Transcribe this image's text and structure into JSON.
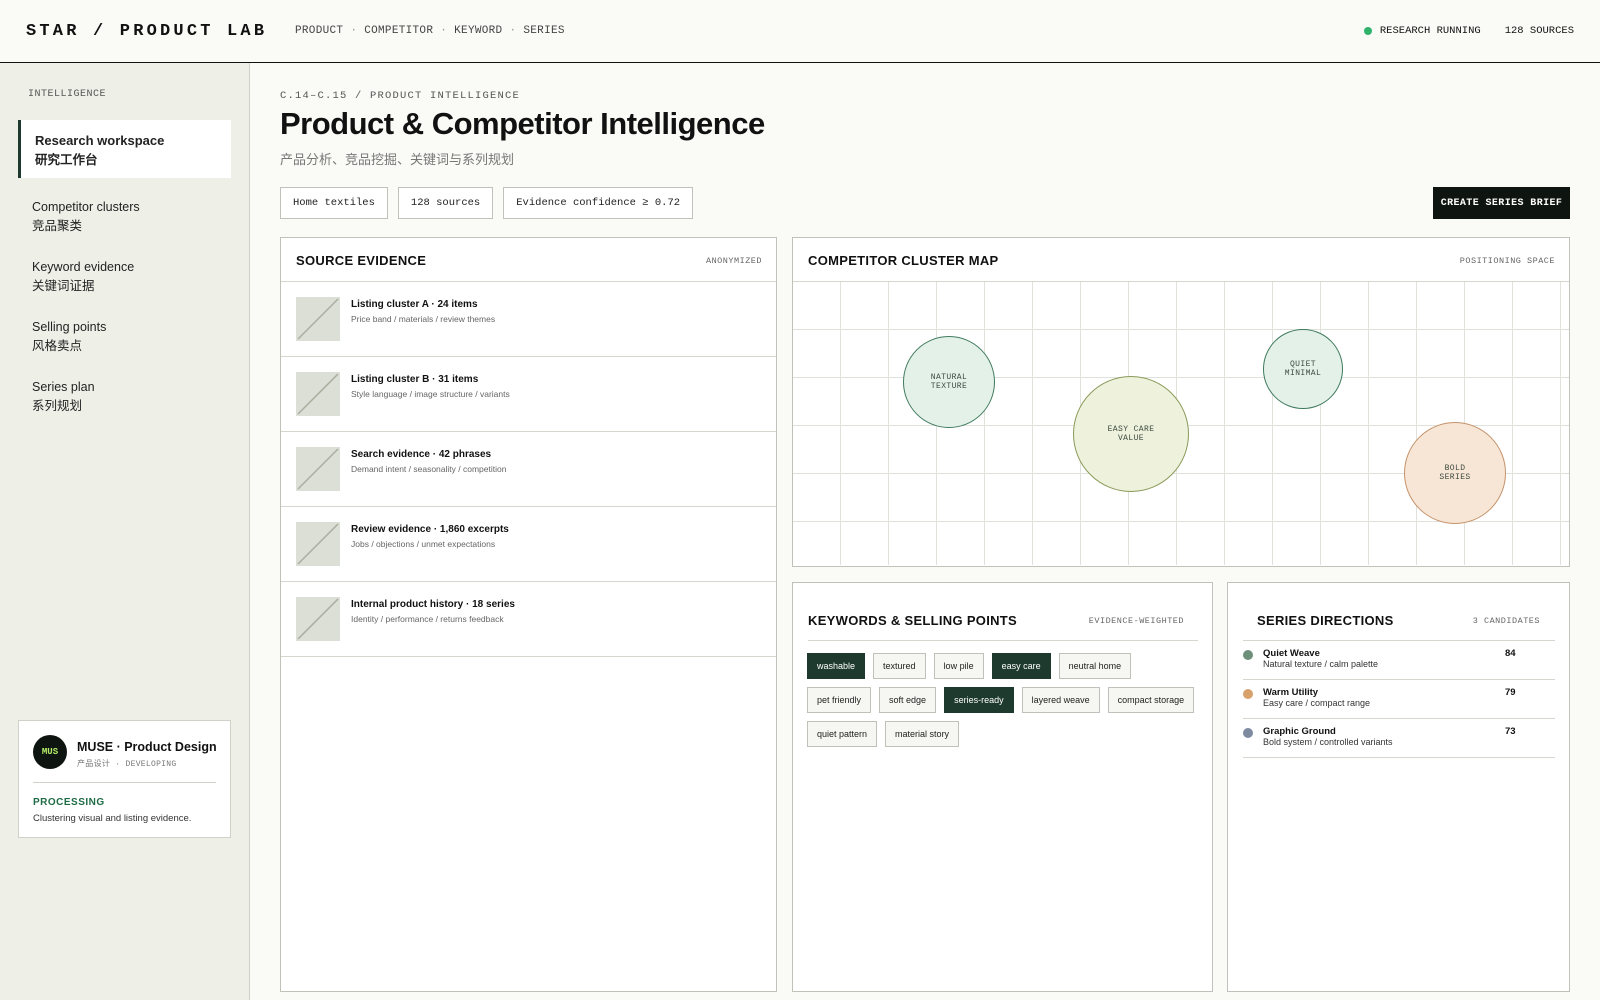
{
  "topbar": {
    "brand": "STAR / PRODUCT LAB",
    "nav": [
      "PRODUCT",
      "COMPETITOR",
      "KEYWORD",
      "SERIES"
    ],
    "nav_sep": "·",
    "status_label": "RESEARCH RUNNING",
    "sources_label": "128 SOURCES",
    "status_color": "#2fb36b"
  },
  "sidebar": {
    "heading": "INTELLIGENCE",
    "items": [
      {
        "en": "Research workspace",
        "zh": "研究工作台",
        "active": true
      },
      {
        "en": "Competitor clusters",
        "zh": "竞品聚类",
        "active": false
      },
      {
        "en": "Keyword evidence",
        "zh": "关键词证据",
        "active": false
      },
      {
        "en": "Selling points",
        "zh": "风格卖点",
        "active": false
      },
      {
        "en": "Series plan",
        "zh": "系列规划",
        "active": false
      }
    ],
    "agent": {
      "avatar": "MUS",
      "name": "MUSE · Product Design",
      "sub": "产品设计 · DEVELOPING",
      "state": "PROCESSING",
      "desc": "Clustering visual and listing evidence."
    }
  },
  "header": {
    "crumb": "C.14–C.15 / PRODUCT INTELLIGENCE",
    "title": "Product & Competitor Intelligence",
    "subtitle": "产品分析、竞品挖掘、关键词与系列规划",
    "chips": [
      "Home textiles",
      "128 sources",
      "Evidence confidence ≥ 0.72"
    ],
    "cta": "CREATE SERIES BRIEF"
  },
  "source_evidence": {
    "title": "SOURCE EVIDENCE",
    "tag": "ANONYMIZED",
    "rows": [
      {
        "title": "Listing cluster A · 24 items",
        "desc": "Price band / materials / review themes"
      },
      {
        "title": "Listing cluster B · 31 items",
        "desc": "Style language / image structure / variants"
      },
      {
        "title": "Search evidence · 42 phrases",
        "desc": "Demand intent / seasonality / competition"
      },
      {
        "title": "Review evidence · 1,860 excerpts",
        "desc": "Jobs / objections / unmet expectations"
      },
      {
        "title": "Internal product history · 18 series",
        "desc": "Identity / performance / returns feedback"
      }
    ]
  },
  "cluster_map": {
    "title": "COMPETITOR CLUSTER MAP",
    "tag": "POSITIONING SPACE",
    "clusters": [
      {
        "line1": "NATURAL",
        "line2": "TEXTURE",
        "fill": "#e4f1e9",
        "stroke": "#3f7a5c"
      },
      {
        "line1": "EASY CARE",
        "line2": "VALUE",
        "fill": "#eef1dc",
        "stroke": "#8a9a5a"
      },
      {
        "line1": "QUIET",
        "line2": "MINIMAL",
        "fill": "#e4f1e9",
        "stroke": "#3f7a5c"
      },
      {
        "line1": "BOLD",
        "line2": "SERIES",
        "fill": "#f7e6d6",
        "stroke": "#c4926a"
      }
    ]
  },
  "keywords": {
    "title": "KEYWORDS & SELLING POINTS",
    "tag": "EVIDENCE-WEIGHTED",
    "items": [
      {
        "label": "washable",
        "on": true
      },
      {
        "label": "textured",
        "on": false
      },
      {
        "label": "low pile",
        "on": false
      },
      {
        "label": "easy care",
        "on": true
      },
      {
        "label": "neutral home",
        "on": false
      },
      {
        "label": "pet friendly",
        "on": false
      },
      {
        "label": "soft edge",
        "on": false
      },
      {
        "label": "series-ready",
        "on": true
      },
      {
        "label": "layered weave",
        "on": false
      },
      {
        "label": "compact storage",
        "on": false
      },
      {
        "label": "quiet pattern",
        "on": false
      },
      {
        "label": "material story",
        "on": false
      }
    ]
  },
  "series": {
    "title": "SERIES DIRECTIONS",
    "tag": "3 CANDIDATES",
    "rows": [
      {
        "name": "Quiet Weave",
        "desc": "Natural texture / calm palette",
        "score": "84",
        "color": "#6e8f7a"
      },
      {
        "name": "Warm Utility",
        "desc": "Easy care / compact range",
        "score": "79",
        "color": "#d8a06a"
      },
      {
        "name": "Graphic Ground",
        "desc": "Bold system / controlled variants",
        "score": "73",
        "color": "#7e8aa0"
      }
    ]
  }
}
